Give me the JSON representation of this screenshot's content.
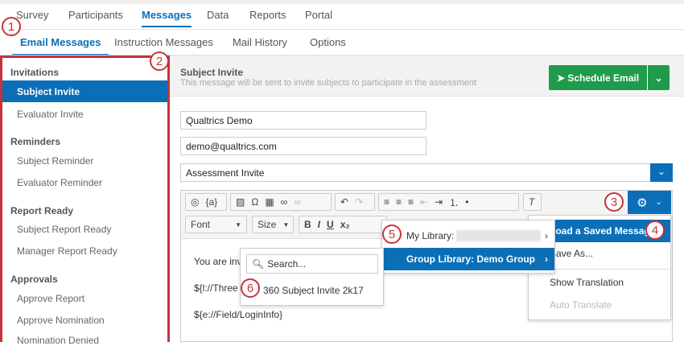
{
  "top_tabs": [
    "Survey",
    "Participants",
    "Messages",
    "Data",
    "Reports",
    "Portal"
  ],
  "active_top_tab": "Messages",
  "sub_tabs": [
    "Email Messages",
    "Instruction Messages",
    "Mail History",
    "Options"
  ],
  "active_sub_tab": "Email Messages",
  "sidebar": {
    "sections": [
      {
        "title": "Invitations",
        "items": [
          "Subject Invite",
          "Evaluator Invite"
        ]
      },
      {
        "title": "Reminders",
        "items": [
          "Subject Reminder",
          "Evaluator Reminder"
        ]
      },
      {
        "title": "Report Ready",
        "items": [
          "Subject Report Ready",
          "Manager Report Ready"
        ]
      },
      {
        "title": "Approvals",
        "items": [
          "Approve Report",
          "Approve Nomination",
          "Nomination Denied"
        ]
      }
    ],
    "selected": "Subject Invite"
  },
  "header": {
    "title": "Subject Invite",
    "subtitle": "This message will be sent to invite subjects to participate in the assessment",
    "schedule_label": "Schedule Email"
  },
  "form": {
    "from_name": "Qualtrics Demo",
    "from_email": "demo@qualtrics.com",
    "subject_select": "Assessment Invite"
  },
  "toolbar": {
    "piped_text": "{a}",
    "font": "Font",
    "size": "Size",
    "bold": "B",
    "italic": "I",
    "underline": "U"
  },
  "body_lines": [
    "You are invi",
    "${l://Three",
    "${e://Field/LoginInfo}"
  ],
  "gear_menu": [
    "Load a Saved Message",
    "Save As...",
    "Show Translation",
    "Auto Translate"
  ],
  "library_menu": {
    "my_library": "My Library:",
    "group_library": "Group Library: Demo Group"
  },
  "search": {
    "placeholder": "Search...",
    "results": [
      "360 Subject Invite 2k17"
    ]
  },
  "callouts": [
    "1",
    "2",
    "3",
    "4",
    "5",
    "6"
  ],
  "colors": {
    "accent": "#0b6fb8",
    "green": "#1f9c4b",
    "callout": "#c7323a"
  }
}
